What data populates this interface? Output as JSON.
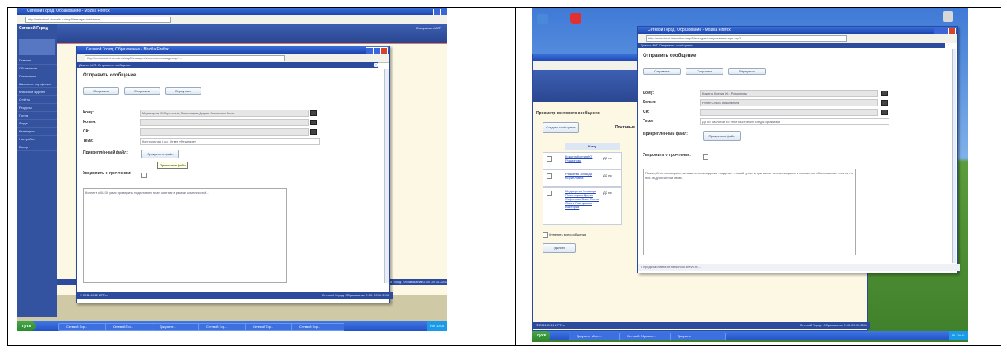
{
  "left": {
    "browser_title": "Сетевой Город. Образование - Mozilla Firefox",
    "address_url": "http://netschool.dnevnik.ru/asp/Messages/addresse...",
    "sidebar_title": "Сетевой Город",
    "sidebar_items": [
      "Главная",
      "Объявления",
      "Расписание",
      "Школьное портфолио",
      "Классный журнал",
      "Отчёты",
      "Ресурсы",
      "Почта",
      "Форум",
      "Календарь",
      "Настройки",
      "Выход"
    ],
    "top_right_text": "Специалист ИКТ",
    "dialog_title": "Сетевой Город. Образование - Mozilla Firefox",
    "dialog_address": "http://netschool.dnevnik.ru/asp/Messages/composemessage.asp?...",
    "dialog_bar": "Диалог ИКТ. Отправить сообщение",
    "heading": "Отправить сообщение",
    "buttons": [
      "Отправить",
      "Сохранить",
      "Вернуться"
    ],
    "labels": {
      "to": "Кому:",
      "copy": "Копия:",
      "bcc": "СК:",
      "subject": "Тема:",
      "attach": "Прикреплённый файл:",
      "notify": "Уведомить о прочтении:"
    },
    "to_value": "Медведева Ю.Сергеевна; Поволоцкая Дарья; Сафонова Вика",
    "subject_value": "Контрольная 8 кл. Ответ «Решение»",
    "attach_button": "Прикрепить файл",
    "tooltip": "Прикрепить файл",
    "body_text": "Коллеги к 08.09 у вас проверить, подготовить план занятия в рамках комплексной...",
    "status_left": "© 2011-2012 ИРТех",
    "status_right": "Сетевой Город. Образование 2.00. 20.10.2011",
    "start_label": "пуск",
    "task_buttons": [
      "Сетевой Гор...",
      "Сетевой Гор...",
      "Документ...",
      "Сетевой Гор...",
      "Сетевой Гор...",
      "Сетевой Гор..."
    ],
    "tray_text": "RU 10:05"
  },
  "right": {
    "dialog_title": "Сетевой Город. Образование - Mozilla Firefox",
    "dialog_address": "http://netschool.dnevnik.ru/asp/Messages/composemessage.asp?...",
    "dialog_bar": "Диалог ИКТ. Отправить сообщение",
    "heading": "Отправить сообщение",
    "buttons": [
      "Отправить",
      "Сохранить",
      "Вернуться"
    ],
    "labels": {
      "to": "Кому:",
      "copy": "Копия:",
      "bcc": "СК:",
      "subject": "Тема:",
      "attach": "Прикреплённый файл:",
      "notify": "Уведомить о прочтении:"
    },
    "to_value": "Кожина Ксения Ю.; Родионова",
    "copy_value": "Ролин Ольга Николаевна",
    "subject_value": "ДЗ по биологии по теме быстрения среды организма",
    "attach_button": "Прикрепить файл",
    "body_text": "Пожалуйста посмотрите, запишите свои задания - задание «новый урок» и два выполненных задания и письменно обоснованные ответы на них. Жду обратной связи.",
    "status_text": "Передача ответа от netschool.dnevn.ru...",
    "back_heading": "Просмотр почтового сообщения",
    "back_button": "Создать сообщение",
    "back_tab": "Почтовые",
    "table_header": "Кому",
    "table_rows": [
      "Кожина Ксения Ю. Родионова",
      "Рыжнёва Зинаида Кирилловна",
      "Медведева Зинаида Поволоцкая Дарья Сафонова Вика Ясень Ольга Павлушова Виктория"
    ],
    "row_prefix": "ДЗ по",
    "delete_all": "Отметить все сообщения",
    "reply_button": "Удалить",
    "status_left": "© 2011-2012 ИРТех",
    "status_right": "Сетевой Город. Образование 2.00. 20.10.2011",
    "start_label": "пуск",
    "task_buttons": [
      "Документ Micro...",
      "Сетевой Образов...",
      "Документ"
    ],
    "tray_text": "RU 10:41"
  }
}
